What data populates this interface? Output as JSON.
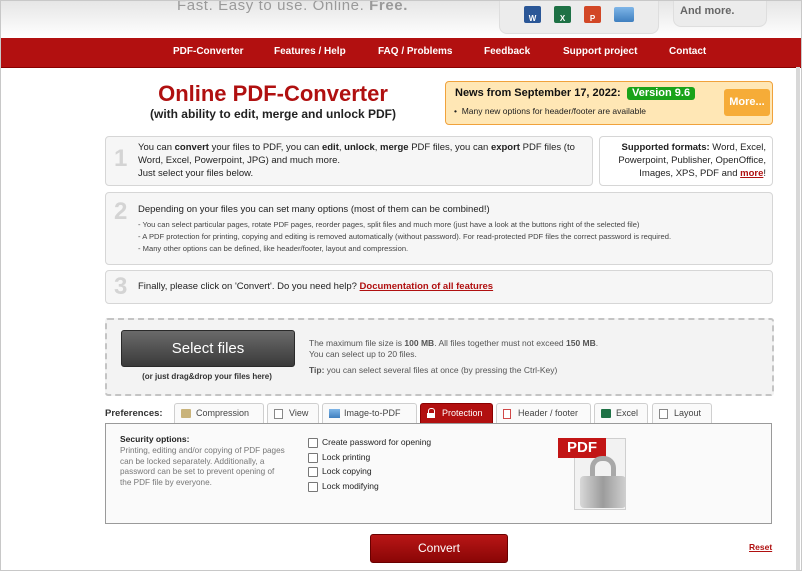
{
  "header": {
    "tagline_a": "Fast. Easy to use. Online.",
    "tagline_b": "Free.",
    "format_icons": [
      {
        "name": "word-icon",
        "letter": "W",
        "color": "#2b5797"
      },
      {
        "name": "excel-icon",
        "letter": "X",
        "color": "#1e7145"
      },
      {
        "name": "powerpoint-icon",
        "letter": "P",
        "color": "#d24726"
      },
      {
        "name": "image-icon",
        "letter": "",
        "color": "#3f7fbf"
      }
    ],
    "and_more": "And more."
  },
  "nav": {
    "items": [
      "PDF-Converter",
      "Features / Help",
      "FAQ / Problems",
      "Feedback",
      "Support project",
      "Contact"
    ]
  },
  "main": {
    "title": "Online PDF-Converter",
    "subtitle": "(with ability to edit, merge and unlock PDF)"
  },
  "news": {
    "title": "News from September 17, 2022:",
    "version": "Version 9.6",
    "item": "Many new options for header/footer are available",
    "more": "More..."
  },
  "steps": {
    "s1": {
      "num": "1",
      "p1": "You can ",
      "b1": "convert",
      "p2": " your files to PDF, you can ",
      "b2": "edit",
      "p3": ", ",
      "b3": "unlock",
      "p4": ", ",
      "b4": "merge",
      "p5": " PDF files, you can ",
      "b5": "export",
      "p6": " PDF files (to",
      "line2": "Word, Excel, Powerpoint, JPG) and much more.",
      "line3": "Just select your files below."
    },
    "formats": {
      "label": "Supported formats:",
      "text": " Word, Excel, Powerpoint, Publisher, OpenOffice, Images, XPS, PDF and ",
      "more": "more",
      "end": "!"
    },
    "s2": {
      "num": "2",
      "head": "Depending on your files you can set many options (most of them can be combined!)",
      "l1": "- You can select particular pages, rotate PDF pages, reorder pages, split files and much more (just have a look at the buttons right of the selected file)",
      "l2": "- A PDF protection for printing, copying and editing is removed automatically (without password). For read-protected PDF files the correct password is required.",
      "l3": "- Many other options can be defined, like header/footer, layout and compression."
    },
    "s3": {
      "num": "3",
      "text": "Finally, please click on 'Convert'. Do you need help? ",
      "link": "Documentation of all features"
    }
  },
  "upload": {
    "button": "Select files",
    "drag": "(or just drag&drop your files here)",
    "max_a": "The maximum file size is ",
    "max_b": "100 MB",
    "max_c": ". All files together must not exceed ",
    "max_d": "150 MB",
    "max_e": ".",
    "limit": "You can select up to 20 files.",
    "tip_label": "Tip:",
    "tip_text": " you can select several files at once (by pressing the Ctrl-Key)"
  },
  "preferences": {
    "label": "Preferences:",
    "tabs": [
      "Compression",
      "View",
      "Image-to-PDF",
      "Protection",
      "Header / footer",
      "Excel",
      "Layout"
    ],
    "active_tab": "Protection",
    "security_title": "Security options:",
    "security_desc": "Printing, editing and/or copying of PDF pages can be locked separately. Additionally, a password can be set to prevent opening of the PDF file by everyone.",
    "options": [
      "Create password for opening",
      "Lock printing",
      "Lock copying",
      "Lock modifying"
    ],
    "pdf_badge": "PDF"
  },
  "actions": {
    "convert": "Convert",
    "reset": "Reset"
  },
  "colors": {
    "brand_red": "#b21010",
    "news_bg": "#ffe7b5",
    "version_green": "#1aa31a",
    "more_orange": "#f6ac38"
  }
}
